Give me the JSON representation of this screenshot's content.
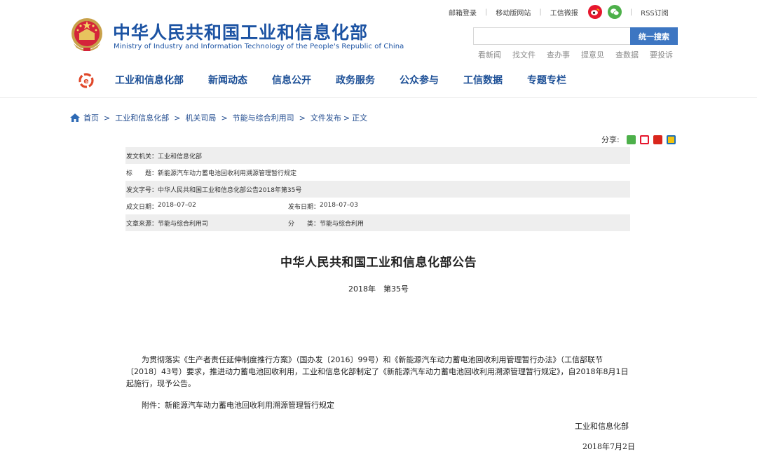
{
  "header": {
    "logo_cn": "中华人民共和国工业和信息化部",
    "logo_en": "Ministry of Industry and Information Technology of the People's Republic of China",
    "top_links": [
      "邮箱登录",
      "移动版网站",
      "工信微报",
      "RSS订阅"
    ],
    "search": {
      "placeholder": "",
      "button": "统一搜索"
    },
    "quick_links": [
      "看新闻",
      "找文件",
      "查办事",
      "提意见",
      "查数据",
      "要投诉"
    ]
  },
  "nav": {
    "items": [
      "工业和信息化部",
      "新闻动态",
      "信息公开",
      "政务服务",
      "公众参与",
      "工信数据",
      "专题专栏"
    ]
  },
  "breadcrumb": [
    "首页",
    "工业和信息化部",
    "机关司局",
    "节能与综合利用司",
    "文件发布",
    "正文"
  ],
  "share": {
    "label": "分享:"
  },
  "info": {
    "issuer_k": "发文机关：",
    "issuer_v": "工业和信息化部",
    "title_k": "标　　题：",
    "title_v": "新能源汽车动力蓄电池回收利用溯源管理暂行规定",
    "docno_k": "发文字号：",
    "docno_v": "中华人民共和国工业和信息化部公告2018年第35号",
    "created_k": "成文日期：",
    "created_v": "2018–07–02",
    "published_k": "发布日期：",
    "published_v": "2018–07–03",
    "source_k": "文章来源：",
    "source_v": "节能与综合利用司",
    "category_k": "分　　类：",
    "category_v": "节能与综合利用"
  },
  "document": {
    "title": "中华人民共和国工业和信息化部公告",
    "number": "2018年　第35号",
    "body": "为贯彻落实《生产者责任延伸制度推行方案》（国办发〔2016〕99号）和《新能源汽车动力蓄电池回收利用管理暂行办法》（工信部联节〔2018〕43号）要求，推进动力蓄电池回收利用，工业和信息化部制定了《新能源汽车动力蓄电池回收利用溯源管理暂行规定》，自2018年8月1日起施行，现予公告。",
    "attachment": "附件：新能源汽车动力蓄电池回收利用溯源管理暂行规定",
    "signature": "工业和信息化部",
    "date": "2018年7月2日"
  },
  "colors": {
    "brand_blue": "#1c53a3",
    "search_button": "#3d76c2",
    "row_shade": "#eeeeee"
  }
}
